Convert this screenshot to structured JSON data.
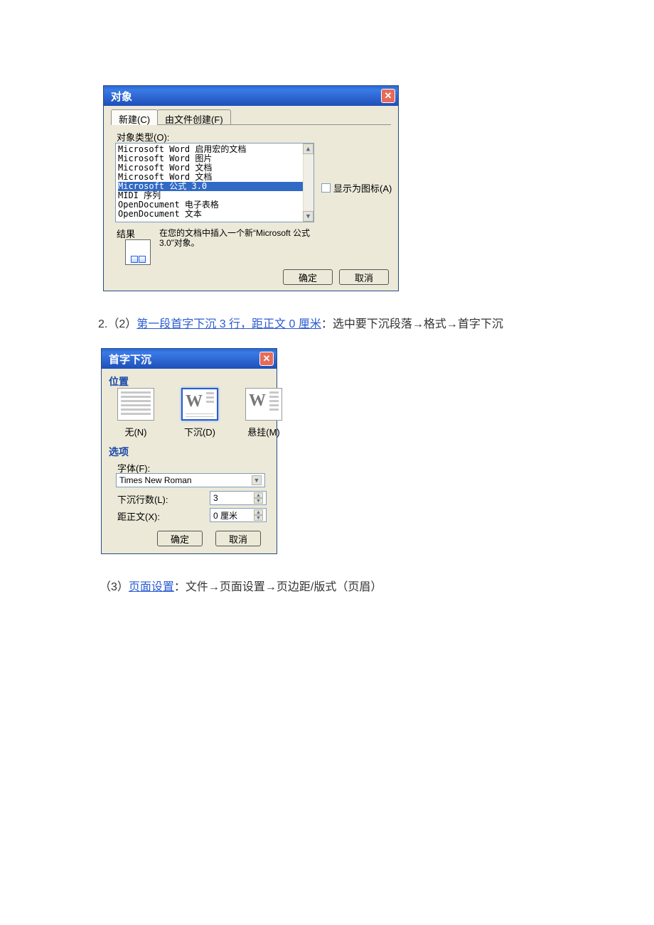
{
  "dialog1": {
    "title": "对象",
    "tabs": {
      "create": "新建(C)",
      "fromfile": "由文件创建(F)"
    },
    "object_type_label": "对象类型(O):",
    "items": [
      "Microsoft Word 启用宏的文档",
      "Microsoft Word 图片",
      "Microsoft Word 文档",
      "Microsoft Word 文档",
      "Microsoft 公式 3.0",
      "MIDI 序列",
      "OpenDocument 电子表格",
      "OpenDocument 文本"
    ],
    "selected_index": 4,
    "show_as_icon": "显示为图标(A)",
    "result_label": "结果",
    "result_text": "在您的文档中插入一个新“Microsoft 公式 3.0”对象。",
    "ok": "确定",
    "cancel": "取消"
  },
  "bodytext": {
    "line1_prefix": "2.（2）",
    "line1_link": "第一段首字下沉 3 行，距正文 0 厘米",
    "line1_rest": "：选中要下沉段落→格式→首字下沉",
    "line2_prefix": "（3）",
    "line2_link": "页面设置",
    "line2_rest": "：文件→页面设置→页边距/版式（页眉）"
  },
  "dialog2": {
    "title": "首字下沉",
    "section_position": "位置",
    "pos_none": "无(N)",
    "pos_drop": "下沉(D)",
    "pos_hang": "悬挂(M)",
    "section_options": "选项",
    "font_label": "字体(F):",
    "font_value": "Times New Roman",
    "lines_label": "下沉行数(L):",
    "lines_value": "3",
    "dist_label": "距正文(X):",
    "dist_value": "0 厘米",
    "ok": "确定",
    "cancel": "取消"
  }
}
